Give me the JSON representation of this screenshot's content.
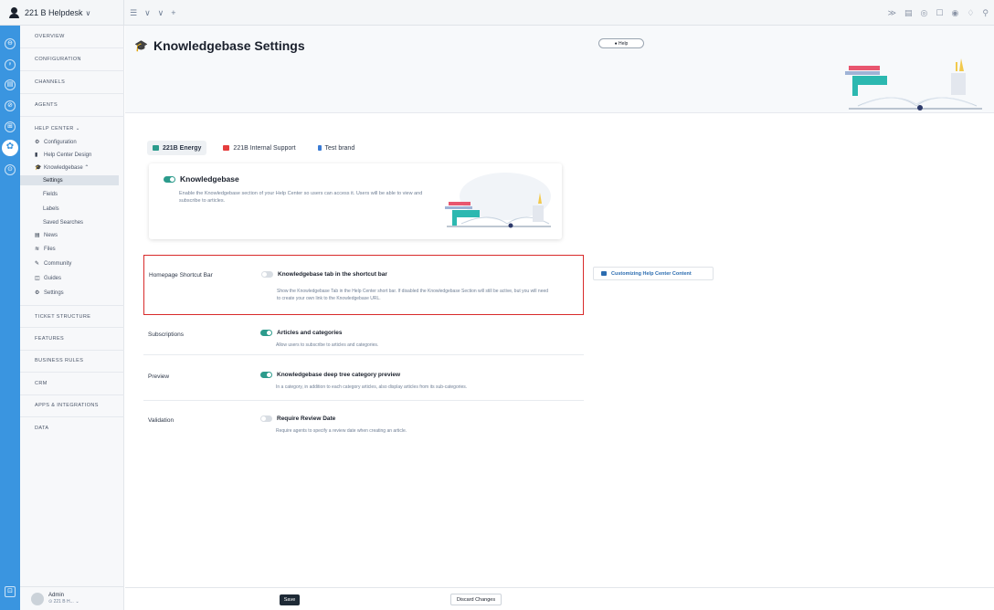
{
  "topbar": {
    "brand_name": "221 B Helpdesk",
    "brand_caret": "∨",
    "tools": [
      "☰",
      "∨",
      "∨",
      "+"
    ],
    "right_icons": [
      "≫",
      "▤",
      "◎",
      "☐",
      "◉",
      "♢",
      "⚲"
    ]
  },
  "rail": {
    "icons": [
      "⊖",
      "♀",
      "▤",
      "⊘",
      "⊞",
      "✿",
      "⊙"
    ],
    "bottom_icon": "⊡"
  },
  "sidebar": {
    "overview": "OVERVIEW",
    "configuration": "CONFIGURATION",
    "channels": "CHANNELS",
    "agents": "AGENTS",
    "help_center": "HELP CENTER ⌄",
    "hc_items": [
      {
        "icon": "⚙",
        "label": "Configuration"
      },
      {
        "icon": "▮",
        "label": "Help Center Design"
      },
      {
        "icon": "🎓",
        "label": "Knowledgebase ⌃"
      }
    ],
    "kb_sub": [
      "Settings",
      "Fields",
      "Labels",
      "Saved Searches"
    ],
    "more_items": [
      {
        "icon": "▤",
        "label": "News"
      },
      {
        "icon": "≋",
        "label": "Files"
      },
      {
        "icon": "✎",
        "label": "Community"
      },
      {
        "icon": "◫",
        "label": "Guides"
      },
      {
        "icon": "⚙",
        "label": "Settings"
      }
    ],
    "sections": [
      "TICKET STRUCTURE",
      "FEATURES",
      "BUSINESS RULES",
      "CRM",
      "APPS & INTEGRATIONS",
      "DATA"
    ],
    "user": {
      "name": "Admin",
      "org": "⊙ 221 B H...",
      "chevron": "⌄"
    }
  },
  "header": {
    "title": "Knowledgebase Settings",
    "help": "● Help"
  },
  "brand_tabs": [
    {
      "label": "221B Energy",
      "color": "#2c9b8c"
    },
    {
      "label": "221B Internal Support",
      "color": "#e53e3e"
    },
    {
      "label": "Test brand",
      "color": "#3a7bd5"
    }
  ],
  "kb_card": {
    "title": "Knowledgebase",
    "description": "Enable the Knowledgebase section of your Help Center so users can access it. Users will be able to view and subscribe to articles."
  },
  "settings": [
    {
      "label": "Homepage Shortcut Bar",
      "option": "Knowledgebase tab in the shortcut bar",
      "enabled": false,
      "description": "Show the Knowledgebase Tab in the Help Center short bar. If disabled the Knowledgebase Section will still be active, but you will need to create your own link to the Knowledgebase URL."
    },
    {
      "label": "Subscriptions",
      "option": "Articles and categories",
      "enabled": true,
      "description": "Allow users to subscribe to articles and categories."
    },
    {
      "label": "Preview",
      "option": "Knowledgebase deep tree category preview",
      "enabled": true,
      "description": "In a category, in addition to each category articles, also display articles from its sub-categories."
    },
    {
      "label": "Validation",
      "option": "Require Review Date",
      "enabled": false,
      "description": "Require agents to specify a review date when creating an article."
    }
  ],
  "side_link": "Customizing Help Center Content",
  "footer": {
    "save": "Save",
    "discard": "Discard Changes"
  }
}
